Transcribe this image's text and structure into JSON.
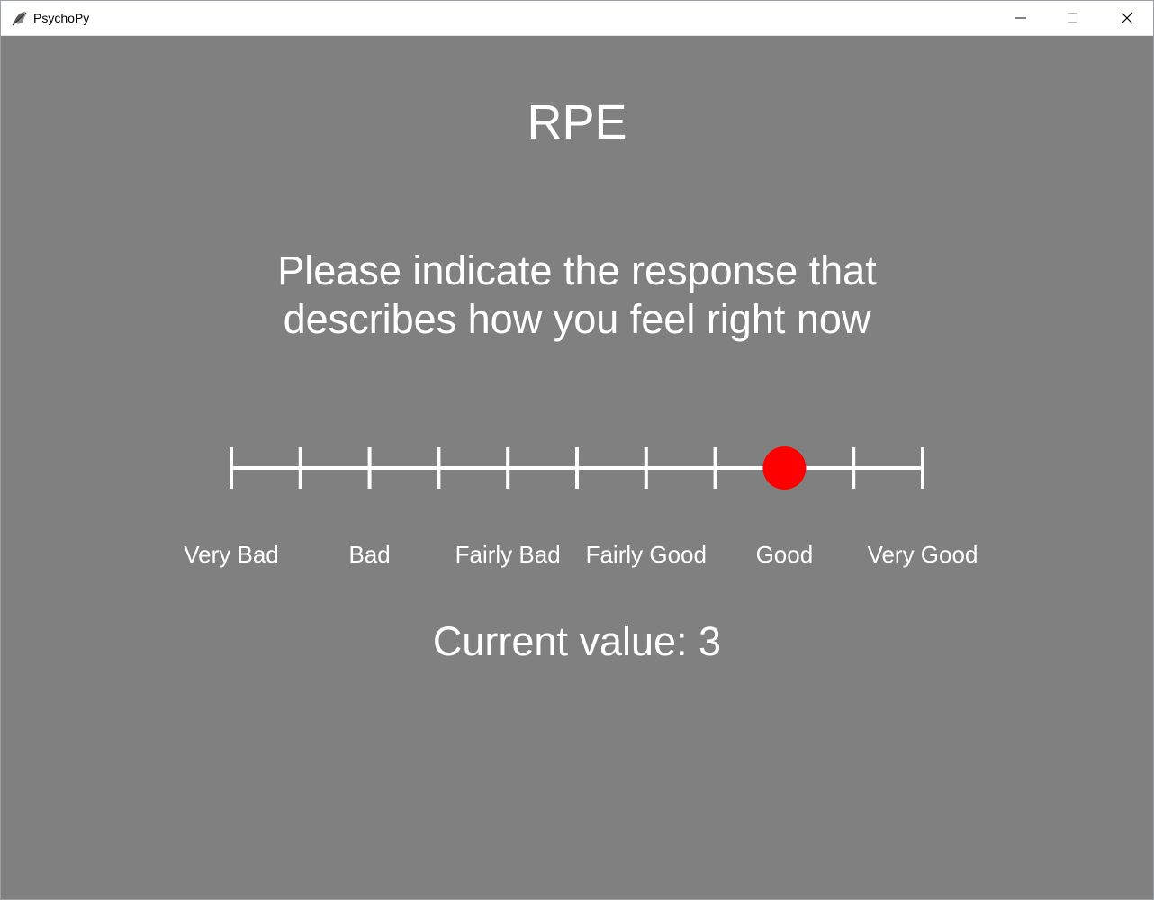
{
  "window": {
    "title": "PsychoPy",
    "icon": "psychopy-logo-icon",
    "controls": [
      "minimize-icon",
      "maximize-icon",
      "close-icon"
    ]
  },
  "screen": {
    "heading": "RPE",
    "instruction_lines": [
      "Please indicate the response that",
      "describes how you feel right now"
    ],
    "current_value_text": "Current value: 3"
  },
  "rating_scale": {
    "tick_count": 11,
    "selected_tick_index": 8,
    "labels": [
      "Very Bad",
      "Bad",
      "Fairly Bad",
      "Fairly Good",
      "Good",
      "Very Good"
    ],
    "label_tick_positions": [
      0,
      2,
      4,
      6,
      8,
      10
    ],
    "colors": {
      "background": "#808080",
      "line": "#ffffff",
      "marker": "#ff0000"
    }
  }
}
